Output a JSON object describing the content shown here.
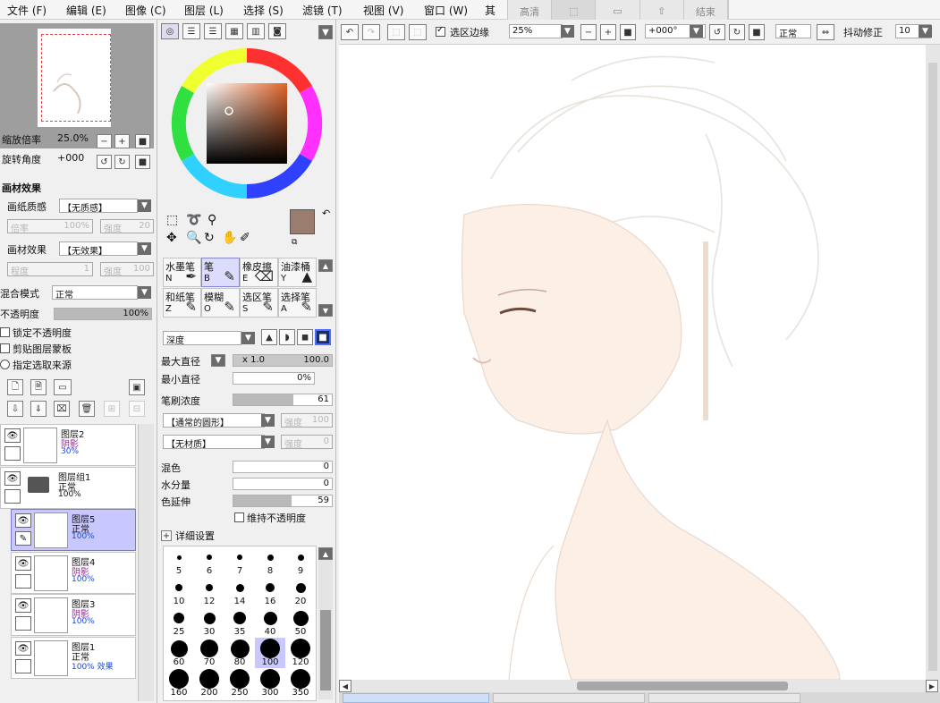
{
  "menubar": {
    "items": [
      "文件 (F)",
      "编辑 (E)",
      "图像 (C)",
      "图层 (L)",
      "选择 (S)",
      "滤镜 (T)",
      "视图 (V)",
      "窗口 (W)",
      "其"
    ]
  },
  "quick_tabs": [
    "高清",
    "⬚",
    "▭",
    "⇧",
    "结束"
  ],
  "navigator": {
    "zoom_label": "缩放倍率",
    "zoom_value": "25.0%",
    "rotate_label": "旋转角度",
    "rotate_value": "+000"
  },
  "texture": {
    "section_label": "画材效果",
    "paper_label": "画纸质感",
    "paper_value": "【无质感】",
    "scale_label": "倍率",
    "scale_value": "100%",
    "strength_label": "强度",
    "strength_value": "20",
    "effect_label": "画材效果",
    "effect_value": "【无效果】",
    "width_label": "程度",
    "width_value": "1",
    "effect_strength_label": "强度",
    "effect_strength_value": "100"
  },
  "layer_props": {
    "blend_label": "混合模式",
    "blend_value": "正常",
    "opacity_label": "不透明度",
    "opacity_value": "100%",
    "opacity_fraction": 1.0,
    "lock_alpha": "锁定不透明度",
    "clip_mask": "剪贴图层蒙板",
    "select_source": "指定选取来源"
  },
  "layers": [
    {
      "name": "图层2",
      "mode": "阴影",
      "opacity": "30%",
      "mode_shade": true
    },
    {
      "name": "图层组1",
      "mode": "正常",
      "opacity": "100%",
      "mode_shade": false
    },
    {
      "name": "图层5",
      "mode": "正常",
      "opacity": "100%",
      "mode_shade": false,
      "selected": true
    },
    {
      "name": "图层4",
      "mode": "阴影",
      "opacity": "100%",
      "mode_shade": true
    },
    {
      "name": "图层3",
      "mode": "阴影",
      "opacity": "100%",
      "mode_shade": true
    },
    {
      "name": "图层1",
      "mode": "正常",
      "opacity": "100% 效果",
      "mode_shade": false
    }
  ],
  "colors": {
    "primary": "#9b7d70",
    "secondary": "#d7eab6",
    "accent_select": "#c8c8ff"
  },
  "tools": [
    {
      "name": "水墨笔",
      "key": "N",
      "icon": "✒"
    },
    {
      "name": "笔",
      "key": "B",
      "icon": "✎",
      "selected": true
    },
    {
      "name": "橡皮擦",
      "key": "E",
      "icon": "⌫"
    },
    {
      "name": "油漆桶",
      "key": "Y",
      "icon": "▲"
    },
    {
      "name": "和纸笔",
      "key": "Z",
      "icon": "✎"
    },
    {
      "name": "模糊",
      "key": "O",
      "icon": "✎"
    },
    {
      "name": "选区笔",
      "key": "S",
      "icon": "✎"
    },
    {
      "name": "选择笔",
      "key": "A",
      "icon": "✎"
    }
  ],
  "brush": {
    "density_label": "深度",
    "max_size_label": "最大直径",
    "max_size_mult": "x 1.0",
    "max_size_value": "100.0",
    "min_size_label": "最小直径",
    "min_size_value": "0%",
    "density2_label": "笔刷浓度",
    "density2_value": "61",
    "density2_fraction": 0.61,
    "shape_value": "【通常的圆形】",
    "shape_strength_label": "强度",
    "shape_strength_value": "100",
    "texture_value": "【无材质】",
    "texture_strength_label": "强度",
    "texture_strength_value": "0",
    "mix_label": "混色",
    "mix_value": "0",
    "water_label": "水分量",
    "water_value": "0",
    "stretch_label": "色延伸",
    "stretch_value": "59",
    "stretch_fraction": 0.59,
    "keep_opacity_label": "维持不透明度",
    "detail_label": "详细设置",
    "sizes": [
      "5",
      "6",
      "7",
      "8",
      "9",
      "10",
      "12",
      "14",
      "16",
      "20",
      "25",
      "30",
      "35",
      "40",
      "50",
      "60",
      "70",
      "80",
      "100",
      "120",
      "160",
      "200",
      "250",
      "300",
      "350"
    ],
    "selected_size": "100"
  },
  "toolbar": {
    "select_edge_label": "选区边缘",
    "zoom_value": "25%",
    "angle_value": "+000°",
    "mode_value": "正常",
    "stabilizer_label": "抖动修正",
    "stabilizer_value": "10"
  }
}
